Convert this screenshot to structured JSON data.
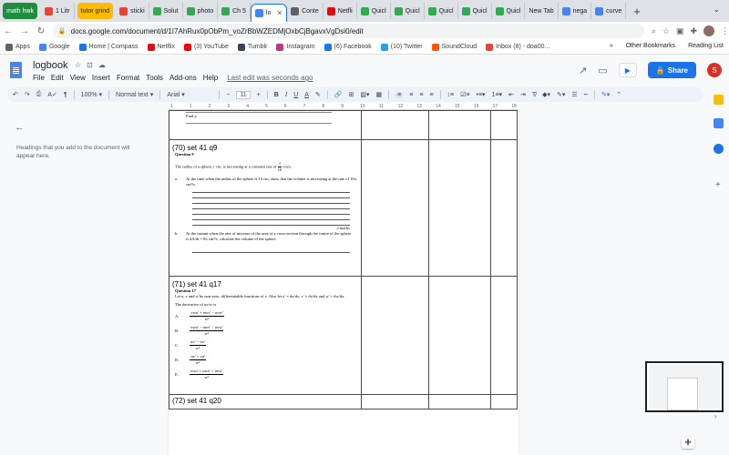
{
  "tabs": [
    {
      "label": "math hwk",
      "style": "group-green",
      "color": ""
    },
    {
      "label": "1 Litr",
      "style": "",
      "color": "#ea4335"
    },
    {
      "label": "tutor grind",
      "style": "group-yellow",
      "color": ""
    },
    {
      "label": "sticki",
      "style": "",
      "color": "#ea4335"
    },
    {
      "label": "Solut",
      "style": "",
      "color": "#34a853"
    },
    {
      "label": "photo",
      "style": "",
      "color": "#34a853"
    },
    {
      "label": "Ch 5",
      "style": "",
      "color": "#34a853"
    },
    {
      "label": "lo",
      "style": "active",
      "color": "#4285f4"
    },
    {
      "label": "Conte",
      "style": "",
      "color": "#5f6368"
    },
    {
      "label": "Netfli",
      "style": "",
      "color": "#e50914"
    },
    {
      "label": "Quicl",
      "style": "",
      "color": "#34a853"
    },
    {
      "label": "Quicl",
      "style": "",
      "color": "#34a853"
    },
    {
      "label": "Quicl",
      "style": "",
      "color": "#34a853"
    },
    {
      "label": "Quicl",
      "style": "",
      "color": "#34a853"
    },
    {
      "label": "Quicl",
      "style": "",
      "color": "#34a853"
    },
    {
      "label": "New Tab",
      "style": "",
      "color": ""
    },
    {
      "label": "nega",
      "style": "",
      "color": "#4285f4"
    },
    {
      "label": "curve",
      "style": "",
      "color": "#4285f4"
    }
  ],
  "newtab_symbol": "+",
  "address": {
    "url": "docs.google.com/document/d/1I7AhRux0pObPm_voZrBbWZEDMjOxbCjBgavxVgDsi0/edit"
  },
  "bookmarks": [
    {
      "label": "Apps",
      "color": "#5f6368"
    },
    {
      "label": "Google",
      "color": "#4285f4"
    },
    {
      "label": "Home | Compass",
      "color": "#1a73e8"
    },
    {
      "label": "Netflix",
      "color": "#e50914"
    },
    {
      "label": "(3) YouTube",
      "color": "#ff0000"
    },
    {
      "label": "Tumblr",
      "color": "#35465c"
    },
    {
      "label": "Instagram",
      "color": "#c13584"
    },
    {
      "label": "(6) Facebook",
      "color": "#1877f2"
    },
    {
      "label": "(10) Twitter",
      "color": "#1da1f2"
    },
    {
      "label": "SoundCloud",
      "color": "#ff5500"
    },
    {
      "label": "Inbox (8) - doa00...",
      "color": "#ea4335"
    }
  ],
  "bookmarks_right": {
    "overflow": "»",
    "other": "Other Bookmarks",
    "reading": "Reading List"
  },
  "doc": {
    "title": "logbook",
    "menus": [
      "File",
      "Edit",
      "View",
      "Insert",
      "Format",
      "Tools",
      "Add-ons",
      "Help"
    ],
    "last_edit": "Last edit was seconds ago",
    "share": "Share",
    "user_initial": "S"
  },
  "toolbar": {
    "zoom": "100%",
    "style": "Normal text",
    "font": "Arial",
    "minus": "−",
    "size": "11",
    "plus": "+",
    "bold": "B",
    "italic": "I",
    "underline": "U",
    "color_a": "A"
  },
  "outline": {
    "hint": "Headings that you add to the document will appear here."
  },
  "ruler": [
    "1",
    "1",
    "2",
    "3",
    "4",
    "5",
    "6",
    "7",
    "8",
    "9",
    "10",
    "11",
    "12",
    "13",
    "14",
    "15",
    "16",
    "17",
    "18"
  ],
  "page": {
    "top_fragment": "Find y.",
    "q70": {
      "title": "(70) set 41 q9",
      "question": "Question 9",
      "stem_before": "The radius of a sphere, r cm, is increasing at a constant rate of",
      "rate_num": "1",
      "rate_den": "10",
      "stem_after": "cm/s.",
      "part_a_label": "a.",
      "part_a": "At the time when the radius of the sphere is 10 cm, show that the volume is increasing at the rate of 10π cm³/s.",
      "marks": "2 marks",
      "part_b_label": "b.",
      "part_b_1": "At the instant when the rate of increase of the area of a cross-section through the centre of the sphere",
      "part_b_2": "is dA/dt = 8π cm²/s, calculate the volume of the sphere."
    },
    "q71": {
      "title": "(71) set 41 q17",
      "question": "Question 17",
      "stem": "Let u, v and w be non-zero, differentiable functions of x. Also let u' = du/dx, v' = dv/dx and w' = dw/dx.",
      "stem2": "The derivative of uv/w is",
      "options": [
        {
          "label": "A.",
          "num": "vwu' + uwv' − uvw'",
          "den": "w²"
        },
        {
          "label": "B.",
          "num": "vwu' − uwv' − uvw'",
          "den": "w²"
        },
        {
          "label": "C.",
          "num": "uv' − vu'",
          "den": "w²"
        },
        {
          "label": "D.",
          "num": "uv' + vu'",
          "den": "w²"
        },
        {
          "label": "E.",
          "num": "vwu' + uwv' + uvw'",
          "den": "w²"
        }
      ]
    },
    "q72": {
      "title": "(72) set 41 q20"
    }
  },
  "colors": {
    "accent": "#1a73e8",
    "doc_blue": "#4285f4",
    "avatar": "#d93025"
  }
}
